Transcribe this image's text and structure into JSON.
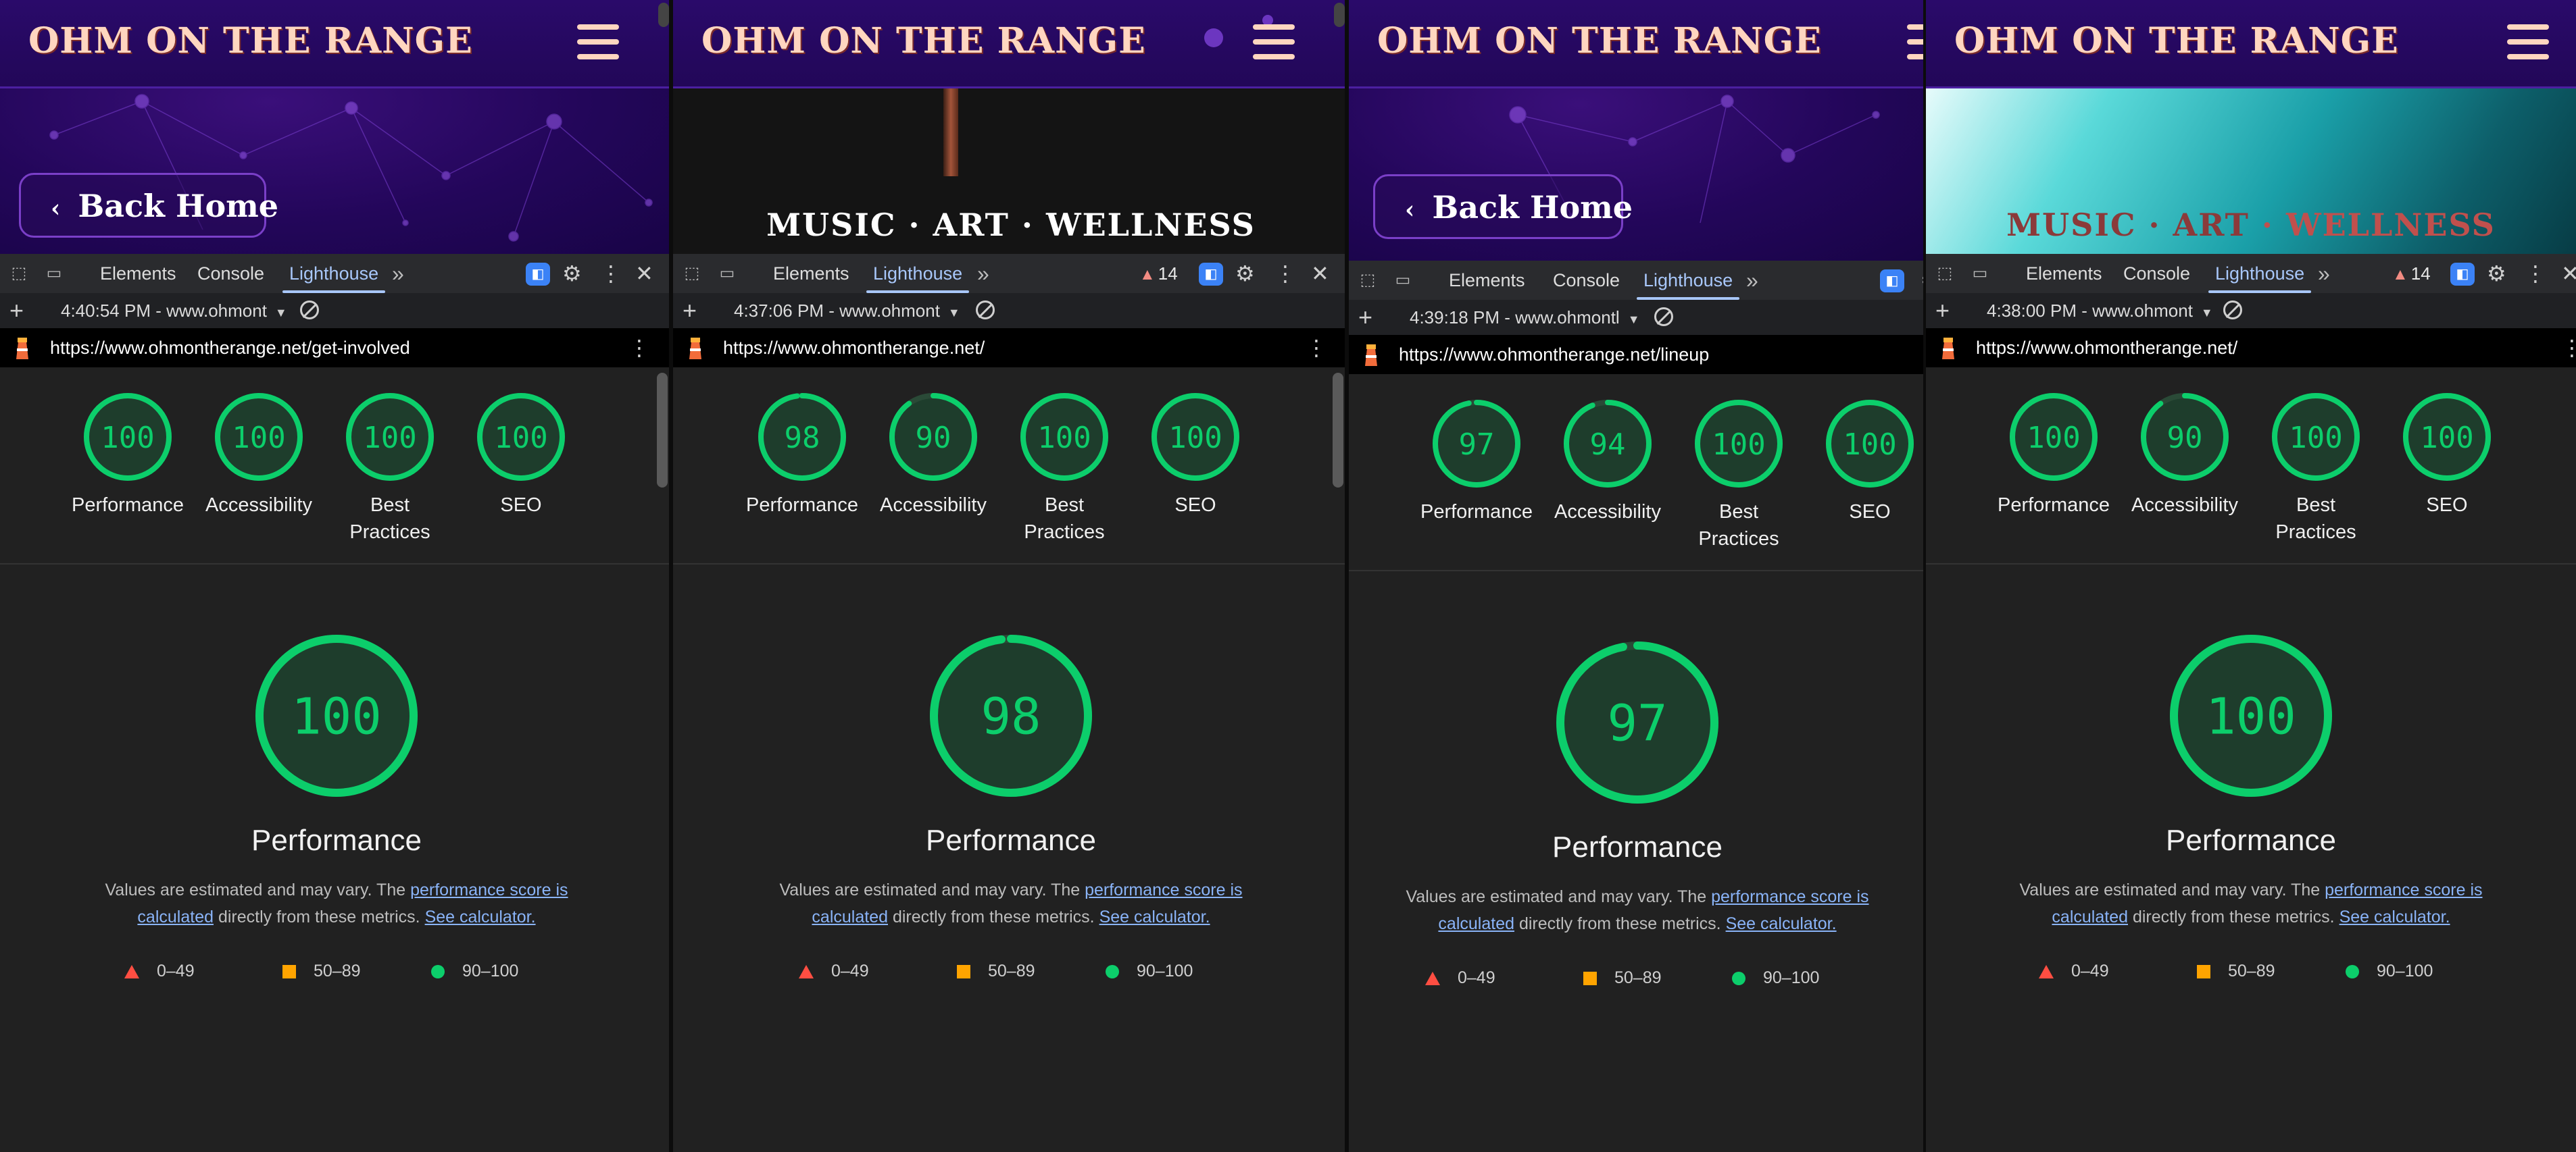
{
  "site": {
    "logo": "OHM ON THE RANGE",
    "back_home": "Back Home",
    "tagline": {
      "music": "MUSIC",
      "art": "ART",
      "wellness": "WELLNESS",
      "sep": "·"
    }
  },
  "devtools": {
    "tabs": [
      "Elements",
      "Console",
      "Lighthouse"
    ],
    "more": "»",
    "kebab": "⋮",
    "close": "✕",
    "gear": "⚙",
    "plus": "+"
  },
  "categories": [
    "Performance",
    "Accessibility",
    "Best Practices",
    "SEO"
  ],
  "category_lines": {
    "best1": "Best",
    "best2": "Practices"
  },
  "performance_section": {
    "title": "Performance",
    "desc_prefix": "Values are estimated and may vary. The ",
    "link1": "performance score is calculated",
    "desc_middle": " directly from these metrics. ",
    "link2": "See calculator.",
    "legend": [
      "0–49",
      "50–89",
      "90–100"
    ]
  },
  "colors": {
    "pass": "#0cce6b",
    "average": "#ffa400",
    "fail": "#ff4e42",
    "gauge_bg": "#1e3d2c"
  },
  "panels": [
    {
      "tabs_visible": [
        "Elements",
        "Console",
        "Lighthouse"
      ],
      "warn_count": "",
      "report": "4:40:54 PM - www.ohmont",
      "url": "https://www.ohmontherange.net/get-involved",
      "scores": [
        100,
        100,
        100,
        100
      ],
      "perf_score": 100
    },
    {
      "tabs_visible": [
        "Elements",
        "Lighthouse"
      ],
      "warn_count": "14",
      "report": "4:37:06 PM - www.ohmont",
      "url": "https://www.ohmontherange.net/",
      "scores": [
        98,
        90,
        100,
        100
      ],
      "perf_score": 98
    },
    {
      "tabs_visible": [
        "Elements",
        "Console",
        "Lighthouse"
      ],
      "warn_count": "",
      "report": "4:39:18 PM - www.ohmontl",
      "url": "https://www.ohmontherange.net/lineup",
      "scores": [
        97,
        94,
        100,
        100
      ],
      "perf_score": 97
    },
    {
      "tabs_visible": [
        "Elements",
        "Console",
        "Lighthouse"
      ],
      "warn_count": "14",
      "report": "4:38:00 PM - www.ohmont",
      "url": "https://www.ohmontherange.net/",
      "scores": [
        100,
        90,
        100,
        100
      ],
      "perf_score": 100
    }
  ]
}
